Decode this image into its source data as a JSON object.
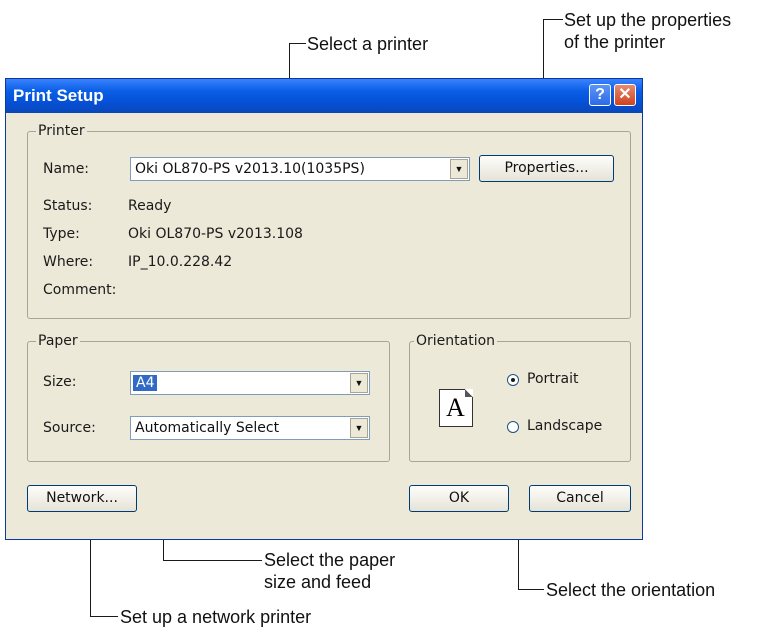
{
  "callouts": {
    "properties": "Set up the properties\nof the printer",
    "select_printer": "Select a printer",
    "paper": "Select the paper\nsize and feed",
    "orientation": "Select the orientation",
    "network": "Set up a network printer"
  },
  "dialog": {
    "title": "Print Setup",
    "help_glyph": "?",
    "close_glyph": "✕"
  },
  "printer": {
    "group_label": "Printer",
    "name_label": "Name:",
    "name_value": "Oki OL870-PS v2013.10(1035PS)",
    "properties_button": "Properties...",
    "status_label": "Status:",
    "status_value": "Ready",
    "type_label": "Type:",
    "type_value": "Oki OL870-PS v2013.108",
    "where_label": "Where:",
    "where_value": "IP_10.0.228.42",
    "comment_label": "Comment:"
  },
  "paper": {
    "group_label": "Paper",
    "size_label": "Size:",
    "size_value": "A4",
    "source_label": "Source:",
    "source_value": "Automatically Select"
  },
  "orientation": {
    "group_label": "Orientation",
    "icon_letter": "A",
    "portrait_label": "Portrait",
    "landscape_label": "Landscape",
    "selected": "Portrait"
  },
  "buttons": {
    "network": "Network...",
    "ok": "OK",
    "cancel": "Cancel"
  },
  "icons": {
    "dropdown": "triangle-down-icon",
    "help": "help-icon",
    "close": "close-icon"
  },
  "colors": {
    "titlebar": "#0a5fe6",
    "dialog_bg": "#ece9d8",
    "selection": "#316ac5",
    "close_button": "#cf4220"
  }
}
